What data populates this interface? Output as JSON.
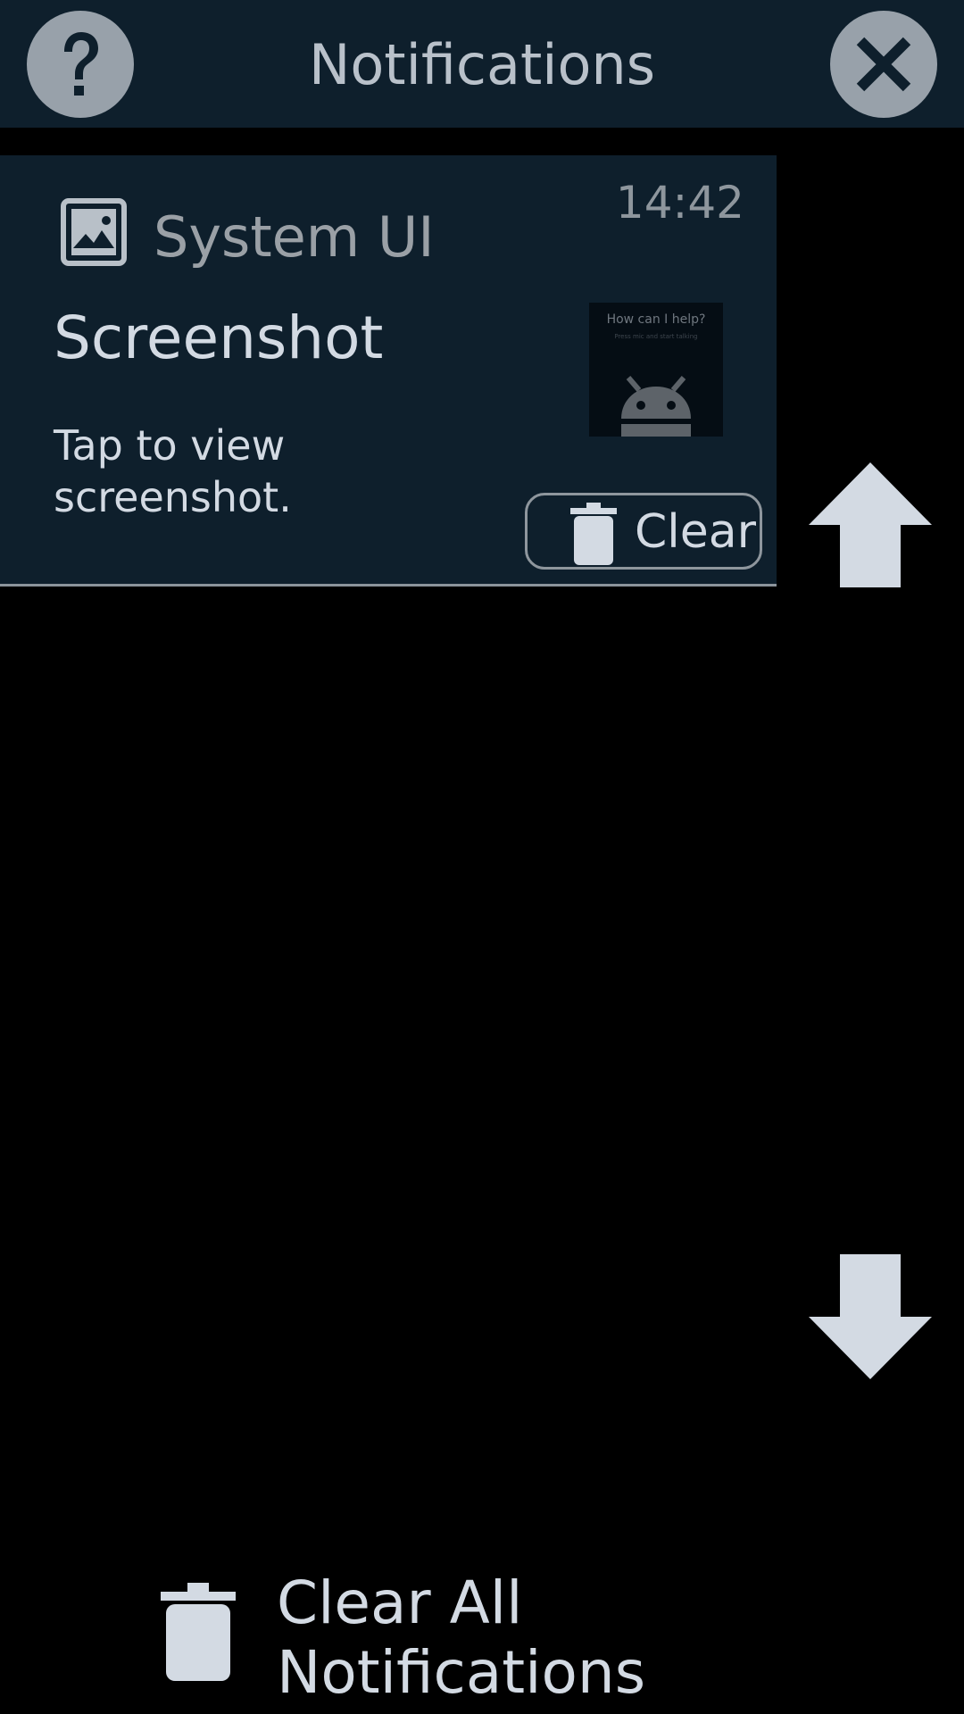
{
  "header": {
    "title": "Notifications",
    "help_icon": "question-icon",
    "close_icon": "close-icon"
  },
  "notification": {
    "app_name": "System UI",
    "app_icon": "image-icon",
    "time": "14:42",
    "title": "Screenshot",
    "text": "Tap to view screenshot.",
    "thumbnail_text": "How can I help?",
    "thumbnail_subtext": "Press mic and start talking",
    "clear_label": "Clear",
    "clear_icon": "trash-icon"
  },
  "scroll": {
    "up_icon": "arrow-up-icon",
    "down_icon": "arrow-down-icon"
  },
  "footer": {
    "clear_all_label": "Clear All Notifications",
    "clear_all_icon": "trash-icon"
  },
  "colors": {
    "header_bg": "#0e1f2c",
    "card_bg": "#0e1f2c",
    "page_bg": "#000000",
    "text": "#d3dae3",
    "muted_text": "#9aa0a6",
    "button_grey": "#98a1aa"
  }
}
